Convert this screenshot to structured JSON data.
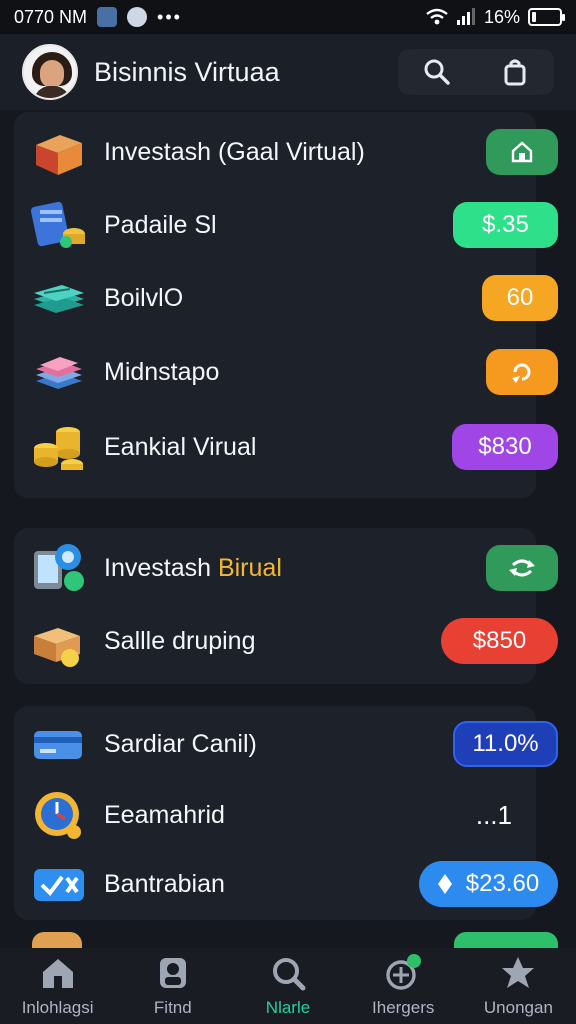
{
  "status_bar": {
    "time": "0770 NM",
    "battery": "16%",
    "battery_fraction": 0.16
  },
  "header": {
    "title": "Bisinnis Virtuaa",
    "actions": [
      "search-icon",
      "bag-icon"
    ]
  },
  "section1": {
    "rows": [
      {
        "label": "Investash (Gaal Virtual)",
        "icon": "box-icon",
        "value": "",
        "value_icon": "house-icon",
        "color": "#2f9a5a"
      },
      {
        "label": "Padaile Sl",
        "icon": "card-icon",
        "value": "$.35",
        "color": "#2fe08a"
      },
      {
        "label": "BoilvlO",
        "icon": "money-stack-icon",
        "value": "60",
        "color": "#f5a623"
      },
      {
        "label": "Midnstapo",
        "icon": "books-icon",
        "value": "",
        "value_icon": "refresh-icon",
        "color": "#f59a1e"
      },
      {
        "label": "Eankial Virual",
        "icon": "coins-icon",
        "value": "$830",
        "color": "#a046e6"
      }
    ]
  },
  "section2": {
    "rows": [
      {
        "label_main": "Investash ",
        "label_accent": "Birual",
        "icon": "phone-icon",
        "value": "",
        "value_icon": "refresh-icon",
        "color": "#2f9a5a"
      },
      {
        "label": "Sallle druping",
        "icon": "boxes-coin-icon",
        "value": "$850",
        "color": "#e84033"
      }
    ]
  },
  "section3": {
    "rows": [
      {
        "label": "Sardiar Canil)",
        "icon": "credit-card-icon",
        "value": "11.0%",
        "color": "#1f3fb8"
      },
      {
        "label": "Eeamahrid",
        "icon": "clock-icon",
        "value": "...1",
        "color": ""
      },
      {
        "label": "Bantrabian",
        "icon": "check-icon",
        "value": "$23.60",
        "value_icon": "diamond-icon",
        "color": "#2d8bf0"
      }
    ]
  },
  "bottom_nav": [
    {
      "label": "Inlohlagsi",
      "icon": "home-icon",
      "active": false
    },
    {
      "label": "Fitnd",
      "icon": "person-icon",
      "active": false
    },
    {
      "label": "Nlarle",
      "icon": "search-icon",
      "active": true
    },
    {
      "label": "Ihergers",
      "icon": "target-icon",
      "active": false
    },
    {
      "label": "Unongan",
      "icon": "star-icon",
      "active": false
    }
  ],
  "colors": {
    "background": "#15181f",
    "panel": "#1c212a",
    "accent_green": "#23d29a"
  }
}
